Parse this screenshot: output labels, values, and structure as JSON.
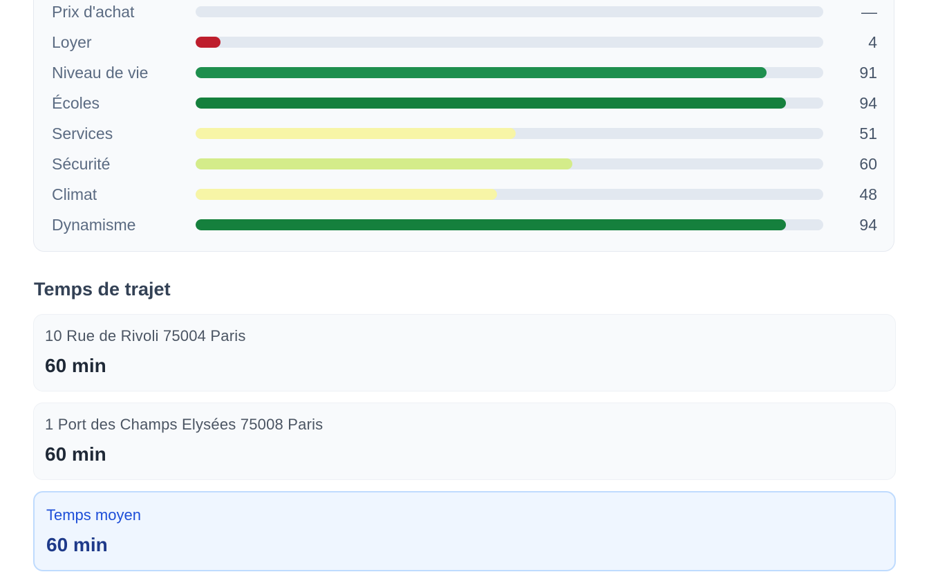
{
  "scores": [
    {
      "label": "Prix d'achat",
      "value_text": "—",
      "fill_fraction": null,
      "color": null
    },
    {
      "label": "Loyer",
      "value_text": "4",
      "fill_fraction": 0.04,
      "color": "#be1e2d"
    },
    {
      "label": "Niveau de vie",
      "value_text": "91",
      "fill_fraction": 0.91,
      "color": "#1e8f4e"
    },
    {
      "label": "Écoles",
      "value_text": "94",
      "fill_fraction": 0.94,
      "color": "#15803d"
    },
    {
      "label": "Services",
      "value_text": "51",
      "fill_fraction": 0.51,
      "color": "#f7f5a6"
    },
    {
      "label": "Sécurité",
      "value_text": "60",
      "fill_fraction": 0.6,
      "color": "#d4ec8a"
    },
    {
      "label": "Climat",
      "value_text": "48",
      "fill_fraction": 0.48,
      "color": "#f7f5a6"
    },
    {
      "label": "Dynamisme",
      "value_text": "94",
      "fill_fraction": 0.94,
      "color": "#15803d"
    }
  ],
  "travel": {
    "title": "Temps de trajet",
    "destinations": [
      {
        "address": "10 Rue de Rivoli 75004 Paris",
        "time": "60 min"
      },
      {
        "address": "1 Port des Champs Elysées 75008 Paris",
        "time": "60 min"
      }
    ],
    "average": {
      "label": "Temps moyen",
      "time": "60 min"
    }
  }
}
